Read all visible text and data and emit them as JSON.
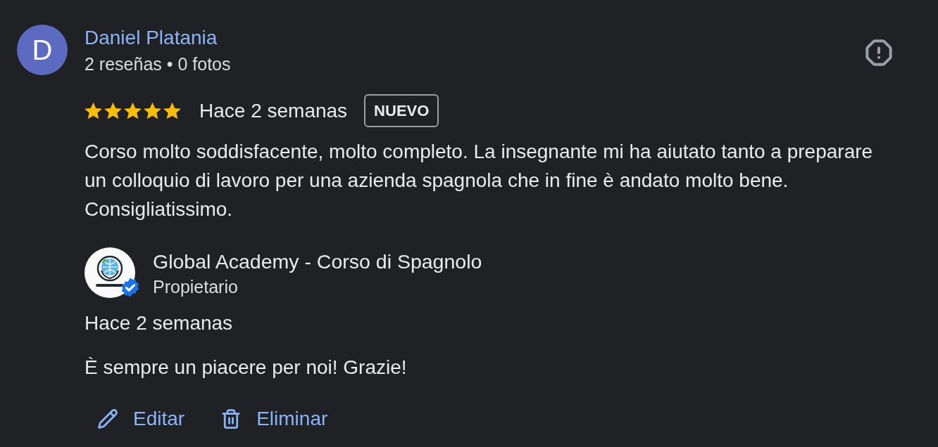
{
  "reviewer": {
    "initial": "D",
    "name": "Daniel Platania",
    "meta": "2 reseñas • 0 fotos"
  },
  "review": {
    "stars": 5,
    "time": "Hace 2 semanas",
    "badge": "NUEVO",
    "text": "Corso molto soddisfacente, molto completo. La insegnante mi ha aiutato tanto a preparare un colloquio di lavoro per una azienda spagnola che in fine è andato molto bene. Consigliatissimo."
  },
  "owner_reply": {
    "name": "Global Academy - Corso di Spagnolo",
    "role": "Propietario",
    "verified": true,
    "time": "Hace 2 semanas",
    "text": "È sempre un piacere per noi! Grazie!"
  },
  "actions": [
    {
      "kind": "edit",
      "label": "Editar"
    },
    {
      "kind": "delete",
      "label": "Eliminar"
    }
  ]
}
